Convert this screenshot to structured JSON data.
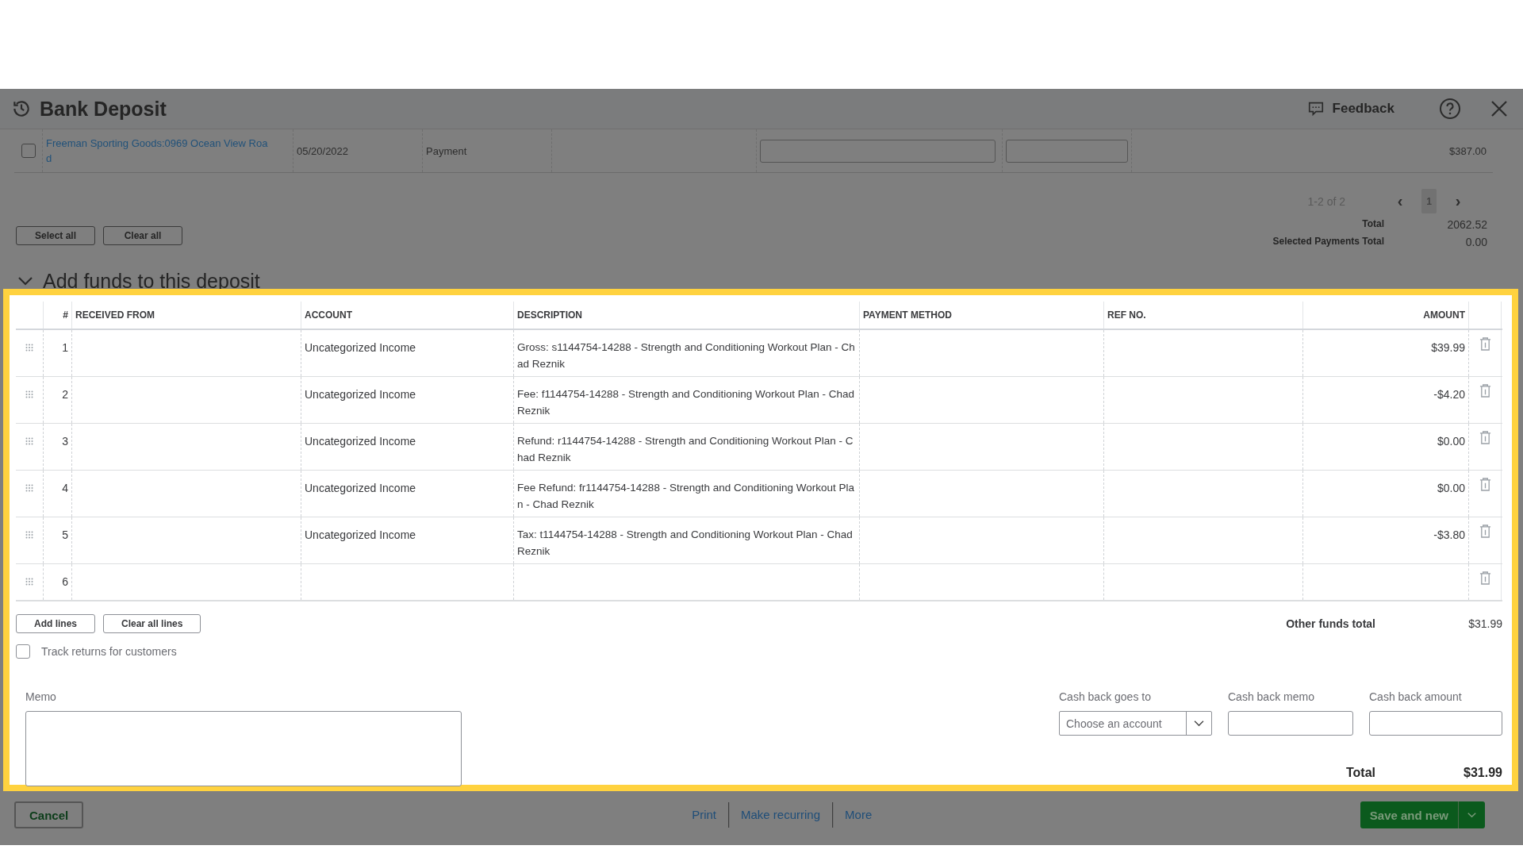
{
  "header": {
    "title": "Bank Deposit",
    "feedback": "Feedback"
  },
  "payments": {
    "rows": [
      {
        "checked": false,
        "received_from": "Freeman Sporting Goods:0969 Ocean View Road",
        "date": "05/20/2022",
        "type": "Payment",
        "amount": "$387.00"
      }
    ],
    "range": "1-2 of 2",
    "prev": "‹",
    "next": "›",
    "pages": [
      {
        "label": "1",
        "selected": true
      }
    ],
    "total_label": "Total",
    "total": "2062.52",
    "selected_label": "Selected Payments Total",
    "selected_total": "0.00",
    "buttons": [
      "Select all",
      "Clear all"
    ]
  },
  "add_funds": {
    "title": "Add funds to this deposit",
    "expanded": true,
    "columns": [
      "#",
      "RECEIVED FROM",
      "ACCOUNT",
      "DESCRIPTION",
      "PAYMENT METHOD",
      "REF NO.",
      "AMOUNT"
    ],
    "rows": [
      {
        "num": "1",
        "account": "Uncategorized Income",
        "description": "Gross: s1144754-14288 - Strength and Conditioning Workout Plan - Chad Reznik",
        "amount": "$39.99"
      },
      {
        "num": "2",
        "account": "Uncategorized Income",
        "description": "Fee: f1144754-14288 - Strength and Conditioning Workout Plan - Chad Reznik",
        "amount": "-$4.20"
      },
      {
        "num": "3",
        "account": "Uncategorized Income",
        "description": "Refund: r1144754-14288 - Strength and Conditioning Workout Plan - Chad Reznik",
        "amount": "$0.00"
      },
      {
        "num": "4",
        "account": "Uncategorized Income",
        "description": "Fee Refund: fr1144754-14288 - Strength and Conditioning Workout Plan - Chad Reznik",
        "amount": "$0.00"
      },
      {
        "num": "5",
        "account": "Uncategorized Income",
        "description": "Tax: t1144754-14288 - Strength and Conditioning Workout Plan - Chad Reznik",
        "amount": "-$3.80"
      },
      {
        "num": "6"
      }
    ],
    "buttons": [
      "Add lines",
      "Clear all lines"
    ],
    "other_total_label": "Other funds total",
    "other_total": "$31.99",
    "track_returns": {
      "label": "Track returns for customers",
      "checked": false
    },
    "memo_label": "Memo",
    "cash_back": {
      "goes_to_label": "Cash back goes to",
      "goes_to_placeholder": "Choose an account",
      "memo_label": "Cash back memo",
      "amount_label": "Cash back amount"
    },
    "total_label": "Total",
    "total": "$31.99"
  },
  "footer": {
    "cancel": "Cancel",
    "links": [
      "Print",
      "Make recurring",
      "More"
    ],
    "save": "Save and new"
  }
}
